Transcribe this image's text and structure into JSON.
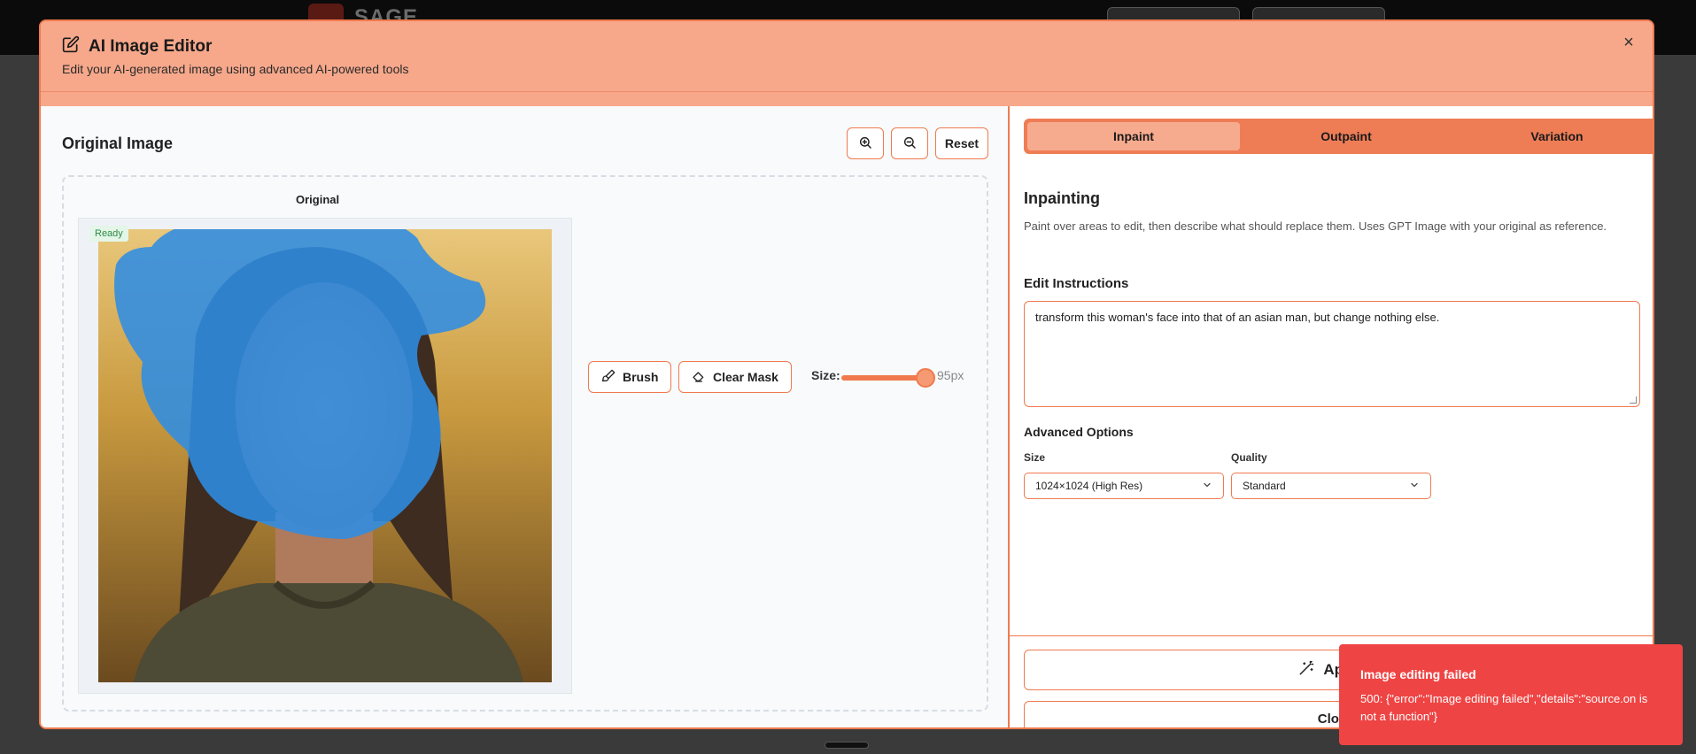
{
  "background": {
    "logo_text": "SAGE"
  },
  "modal": {
    "title": "AI Image Editor",
    "subtitle": "Edit your AI-generated image using advanced AI-powered tools",
    "close_label": "×"
  },
  "left": {
    "title": "Original Image",
    "reset_label": "Reset",
    "canvas_label": "Original",
    "status_badge": "Ready",
    "brush_label": "Brush",
    "clear_mask_label": "Clear Mask",
    "size_label": "Size:",
    "size_value": "95px",
    "brush_size_fraction": 0.95
  },
  "right": {
    "tabs": [
      {
        "label": "Inpaint",
        "active": true
      },
      {
        "label": "Outpaint",
        "active": false
      },
      {
        "label": "Variation",
        "active": false
      }
    ],
    "section_title": "Inpainting",
    "section_desc": "Paint over areas to edit, then describe what should replace them. Uses GPT Image with your original as reference.",
    "instructions_label": "Edit Instructions",
    "instructions_value": "transform this woman's face into that of an asian man, but change nothing else.",
    "advanced_label": "Advanced Options",
    "size_field_label": "Size",
    "size_selected": "1024×1024 (High Res)",
    "quality_field_label": "Quality",
    "quality_selected": "Standard",
    "apply_label": "Apply",
    "close_label": "Clos"
  },
  "toast": {
    "title": "Image editing failed",
    "message": "500: {\"error\":\"Image editing failed\",\"details\":\"source.on is not a function\"}"
  },
  "colors": {
    "accent": "#f07a4e",
    "header_bg": "#f7a88b",
    "error": "#ef4444",
    "mask": "#2f8de4"
  }
}
